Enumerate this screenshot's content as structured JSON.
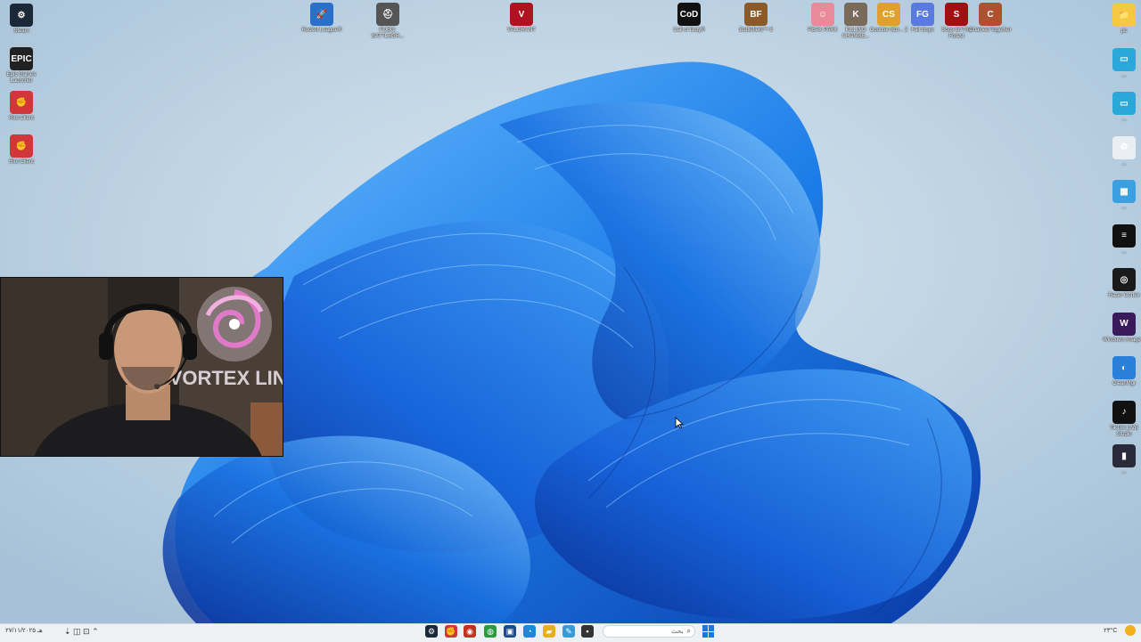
{
  "desktop_icons_left": [
    {
      "label": "Steam",
      "color": "#1b2838",
      "glyph": "⚙"
    },
    {
      "label": "Epic Games Launcher",
      "color": "#222222",
      "glyph": "EPIC"
    },
    {
      "label": "Riot Client",
      "color": "#d13639",
      "glyph": "✊"
    },
    {
      "label": "Riot Client",
      "color": "#d13639",
      "glyph": "✊"
    }
  ],
  "desktop_icons_top": [
    {
      "label": "Rocket League®",
      "color": "#2a6fc9",
      "glyph": "🚀"
    },
    {
      "label": "PUBG: BATTLEGR...",
      "color": "#555555",
      "glyph": "⛑"
    },
    {
      "label": "VALORANT",
      "color": "#b0121f",
      "glyph": "V"
    },
    {
      "label": "Call of Duty®",
      "color": "#111111",
      "glyph": "CoD"
    },
    {
      "label": "Battlefield™ 6",
      "color": "#8a5a2a",
      "glyph": "BF"
    },
    {
      "label": "PEAK PARK",
      "color": "#e98a9a",
      "glyph": "☺"
    },
    {
      "label": "KILLING CHAMBE...",
      "color": "#7a6a5a",
      "glyph": "K"
    },
    {
      "label": "Counter-Stri... 2",
      "color": "#e0a030",
      "glyph": "CS"
    },
    {
      "label": "Fall Guys",
      "color": "#5a7ae0",
      "glyph": "FG"
    },
    {
      "label": "Sons Of The Forest",
      "color": "#a01010",
      "glyph": "S"
    },
    {
      "label": "Chained Together",
      "color": "#b05030",
      "glyph": "C"
    }
  ],
  "desktop_icons_right": [
    {
      "label": "pc",
      "color": "#f5c842",
      "glyph": "📁"
    },
    {
      "label": "...",
      "color": "#2aa8d8",
      "glyph": "▭"
    },
    {
      "label": "...",
      "color": "#2aa8d8",
      "glyph": "▭"
    },
    {
      "label": "...",
      "color": "#e8eef4",
      "glyph": "♻"
    },
    {
      "label": "...",
      "color": "#3aa0e0",
      "glyph": "▦"
    },
    {
      "label": "...",
      "color": "#111111",
      "glyph": "≡"
    },
    {
      "label": "Razer Cortex",
      "color": "#1a1a1a",
      "glyph": "◎"
    },
    {
      "label": "Windows Image...",
      "color": "#3a1a5a",
      "glyph": "W"
    },
    {
      "label": "CleanMgr",
      "color": "#2a80d8",
      "glyph": "◐"
    },
    {
      "label": "TikTok LIVE Studio",
      "color": "#111111",
      "glyph": "♪"
    },
    {
      "label": "...",
      "color": "#2a2a3a",
      "glyph": "▮"
    }
  ],
  "webcam": {
    "brand_text": "VORTEX LINE"
  },
  "taskbar": {
    "search_placeholder": "بحث",
    "apps": [
      {
        "name": "steam-taskbar",
        "glyph": "⚙",
        "color": "#1b2838"
      },
      {
        "name": "riot-taskbar",
        "glyph": "✊",
        "color": "#d13639"
      },
      {
        "name": "app-taskbar",
        "glyph": "◉",
        "color": "#c23020"
      },
      {
        "name": "chrome-taskbar",
        "glyph": "◍",
        "color": "#2a9a40"
      },
      {
        "name": "store-taskbar",
        "glyph": "▣",
        "color": "#1a4a8a"
      },
      {
        "name": "edge-taskbar",
        "glyph": "◔",
        "color": "#1a8ad8"
      },
      {
        "name": "explorer-taskbar",
        "glyph": "▰",
        "color": "#e8b020"
      },
      {
        "name": "paint-taskbar",
        "glyph": "✎",
        "color": "#3a9ad8"
      },
      {
        "name": "terminal-taskbar",
        "glyph": "▪",
        "color": "#333333"
      }
    ],
    "tray_left": "ﻫـ  ۲۷/۱۱/۲۰۲۵",
    "tray_right": "٢٣°C"
  }
}
